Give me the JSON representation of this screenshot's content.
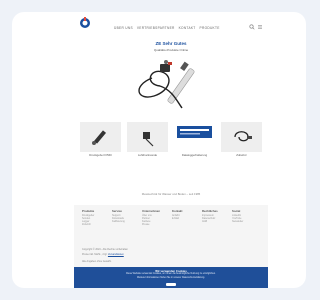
{
  "header": {
    "logo_text": "",
    "nav": [
      "ÜBER UNS",
      "VERTRIEBSPARTNER",
      "KONTAKT",
      "PRODUKTE"
    ],
    "search_icon": "search-icon",
    "menu_icon": "menu-icon"
  },
  "hero": {
    "title": "ZE Sehr Gutes",
    "subtitle": "Qualitäts-Produkte Online"
  },
  "products": [
    {
      "label": "Druckgeber FI560"
    },
    {
      "label": "Luftdrucksonde"
    },
    {
      "label": "Dataloggerhalterung"
    },
    {
      "label": "Zubehör"
    }
  ],
  "tagline": "Messtechnik für Wasser und Boden – seit 1985",
  "footer": {
    "columns": [
      {
        "heading": "Produkte",
        "links": [
          "Druckgeber",
          "Sonden",
          "Logger",
          "Zubehör"
        ]
      },
      {
        "heading": "Service",
        "links": [
          "Support",
          "Downloads",
          "Kalibrierung"
        ]
      },
      {
        "heading": "Unternehmen",
        "links": [
          "Über uns",
          "Partner",
          "Karriere",
          "Presse"
        ]
      },
      {
        "heading": "Kontakt",
        "links": [
          "Anfahrt",
          "E-Mail"
        ]
      },
      {
        "heading": "Rechtliches",
        "links": [
          "Impressum",
          "Datenschutz",
          "AGB"
        ]
      },
      {
        "heading": "Social",
        "links": [
          "LinkedIn",
          "YouTube",
          "Newsletter"
        ]
      }
    ],
    "line1": "Copyright © 2024 - Alle Rechte vorbehalten",
    "line2": "Preise inkl. MwSt., zzgl.",
    "line2_link": "Versandkosten",
    "line3": "Alle Angaben ohne Gewähr."
  },
  "cookie": {
    "title": "Wir verwenden Cookies",
    "text1": "Diese Website verwendet Cookies, um Ihnen die bestmögliche Nutzung zu ermöglichen.",
    "text2": "Weitere Informationen finden Sie in unserer Datenschutzerklärung.",
    "button": "OK"
  }
}
